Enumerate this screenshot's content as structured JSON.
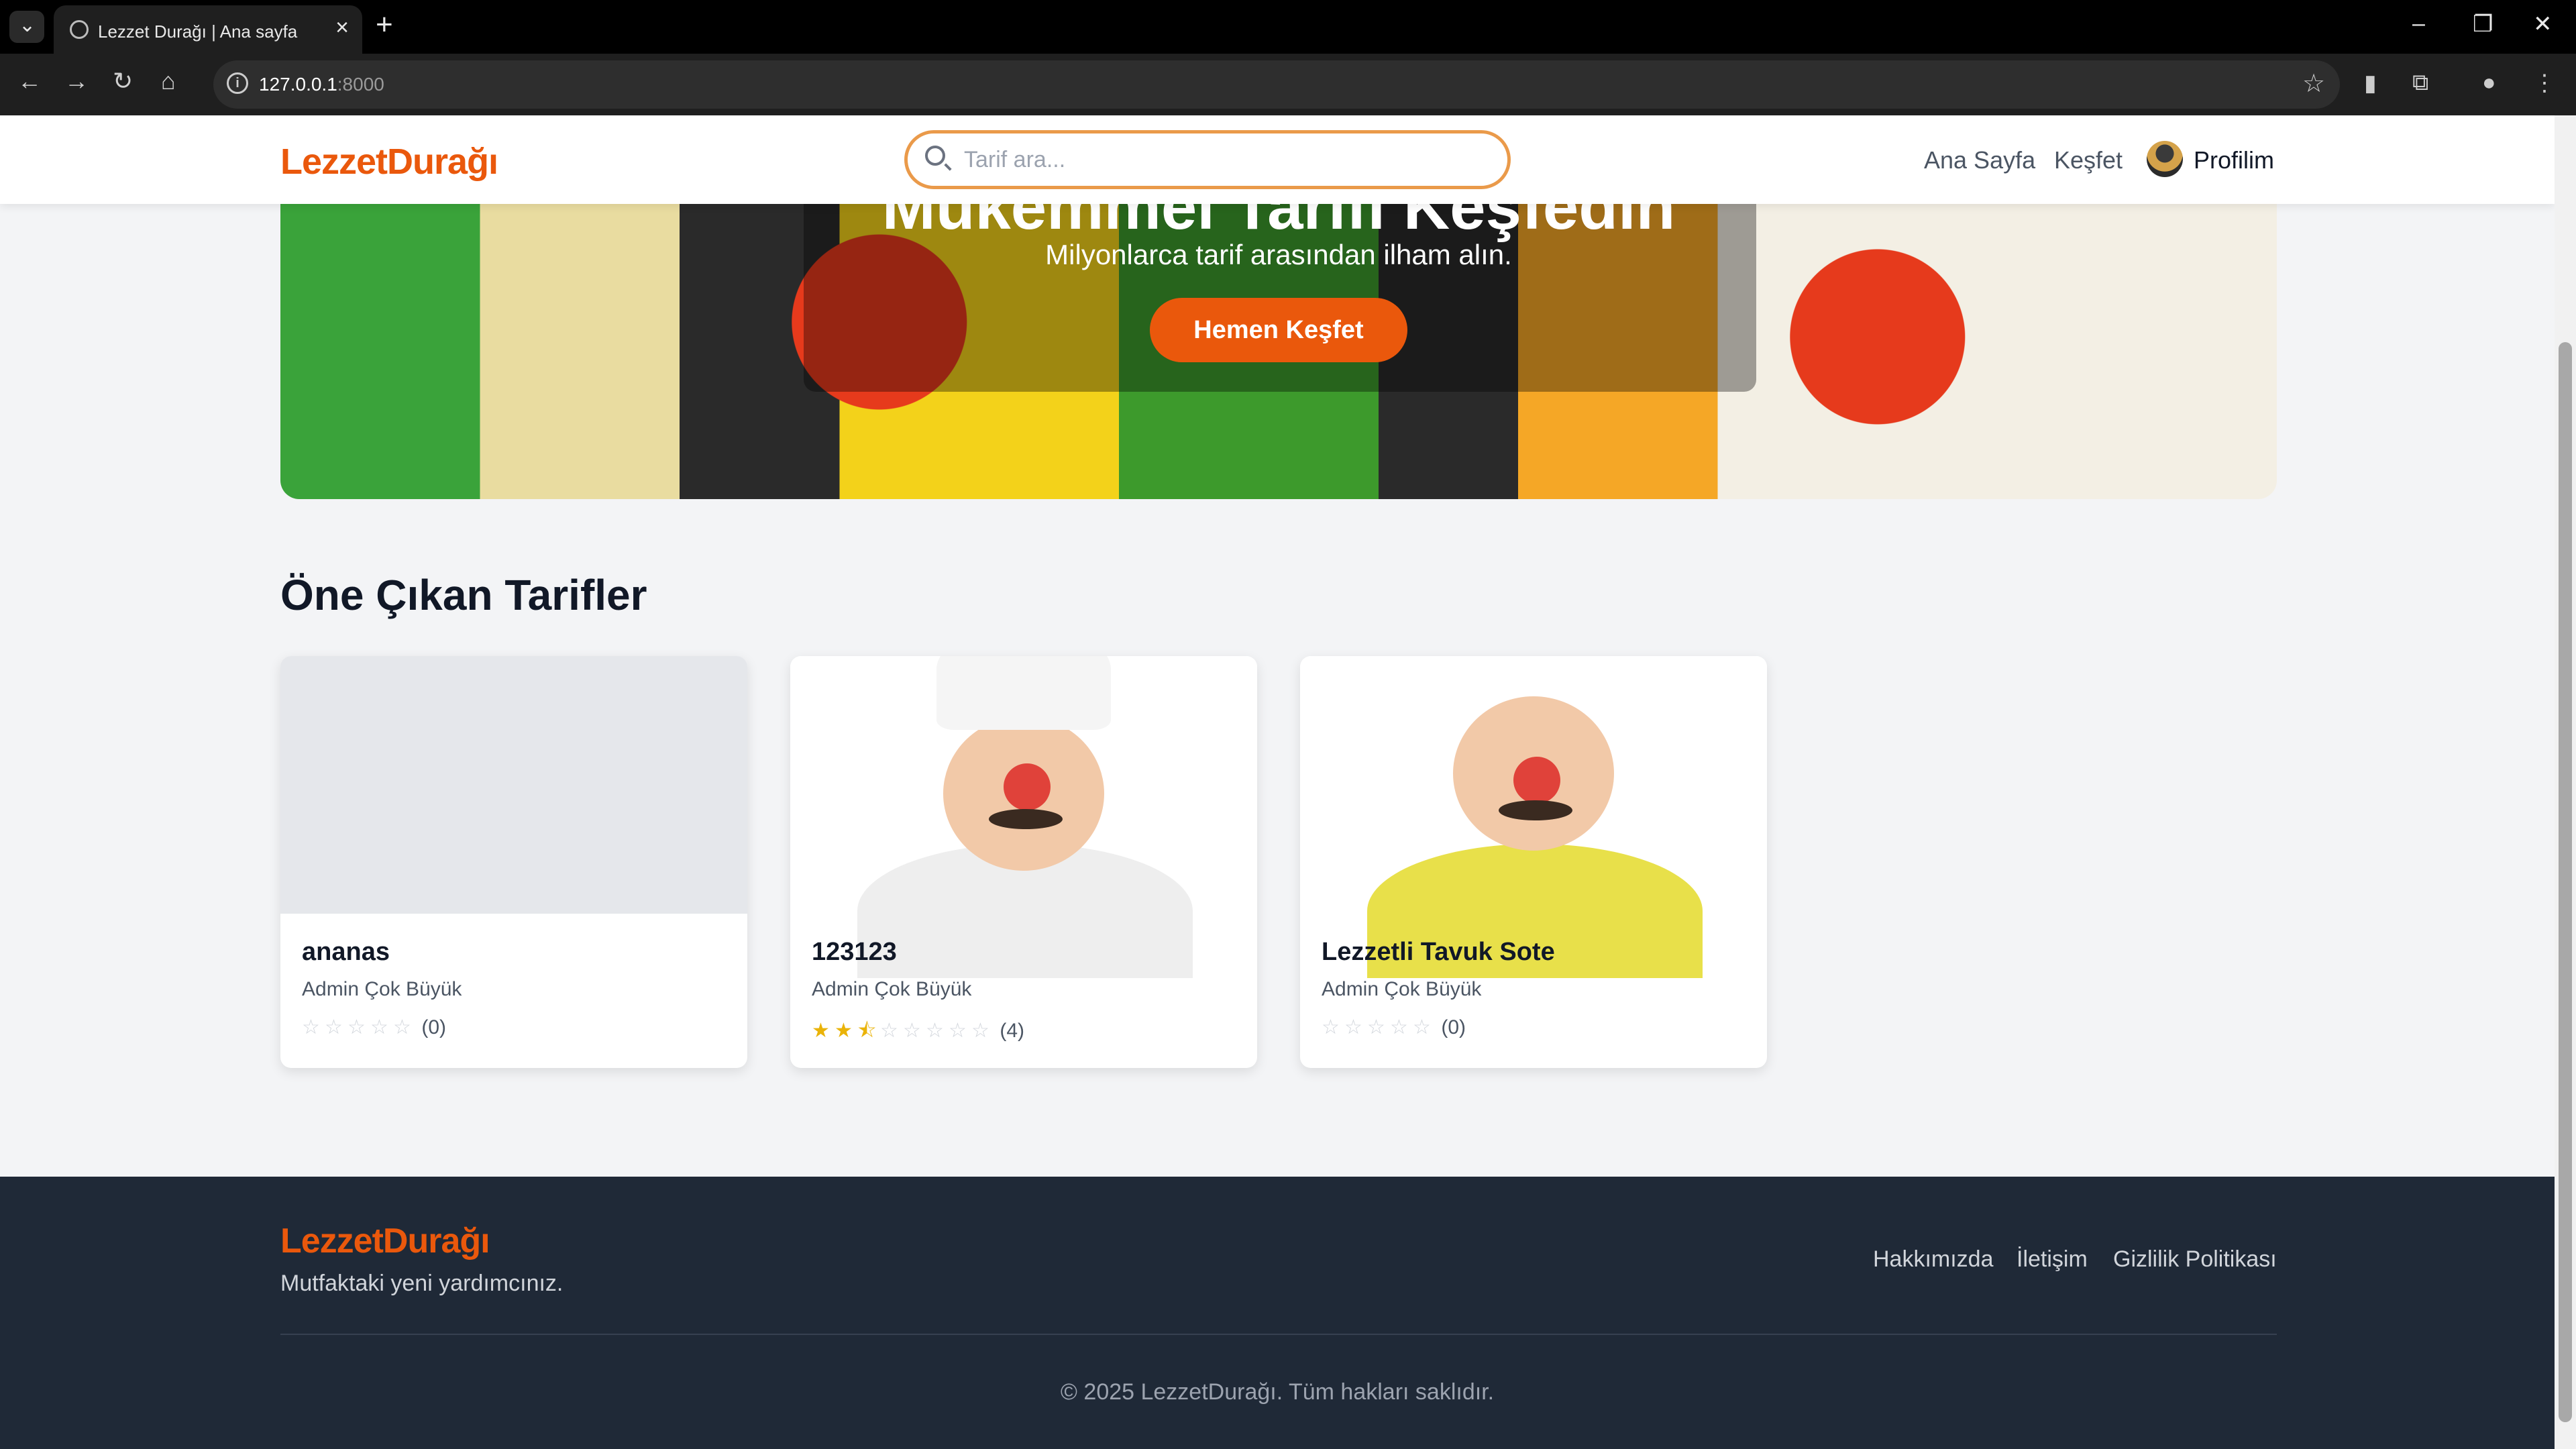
{
  "browser": {
    "tab_title": "Lezzet Durağı | Ana sayfa",
    "url_host": "127.0.0.1",
    "url_port": ":8000",
    "new_tab": "+",
    "close_tab": "×"
  },
  "header": {
    "logo": "LezzetDurağı",
    "search_placeholder": "Tarif ara...",
    "nav": [
      "Ana Sayfa",
      "Keşfet"
    ],
    "profile_label": "Profilim"
  },
  "hero": {
    "title": "Mükemmel Tarifi Keşfedin",
    "subtitle": "Milyonlarca tarif arasından ilham alın.",
    "cta": "Hemen Keşfet"
  },
  "featured": {
    "title": "Öne Çıkan Tarifler",
    "cards": [
      {
        "title": "ananas",
        "author": "Admin Çok Büyük",
        "rating": 0,
        "count": "(0)"
      },
      {
        "title": "123123",
        "author": "Admin Çok Büyük",
        "rating": 2.5,
        "count": "(4)"
      },
      {
        "title": "Lezzetli Tavuk Sote",
        "author": "Admin Çok Büyük",
        "rating": 0,
        "count": "(0)"
      }
    ]
  },
  "footer": {
    "logo": "LezzetDurağı",
    "tagline": "Mutfaktaki yeni yardımcınız.",
    "links": [
      "Hakkımızda",
      "İletişim",
      "Gizlilik Politikası"
    ],
    "copyright": "© 2025 LezzetDurağı. Tüm hakları saklıdır."
  },
  "colors": {
    "accent": "#ea580c",
    "footer_bg": "#1f2937",
    "star_on": "#eab308"
  }
}
